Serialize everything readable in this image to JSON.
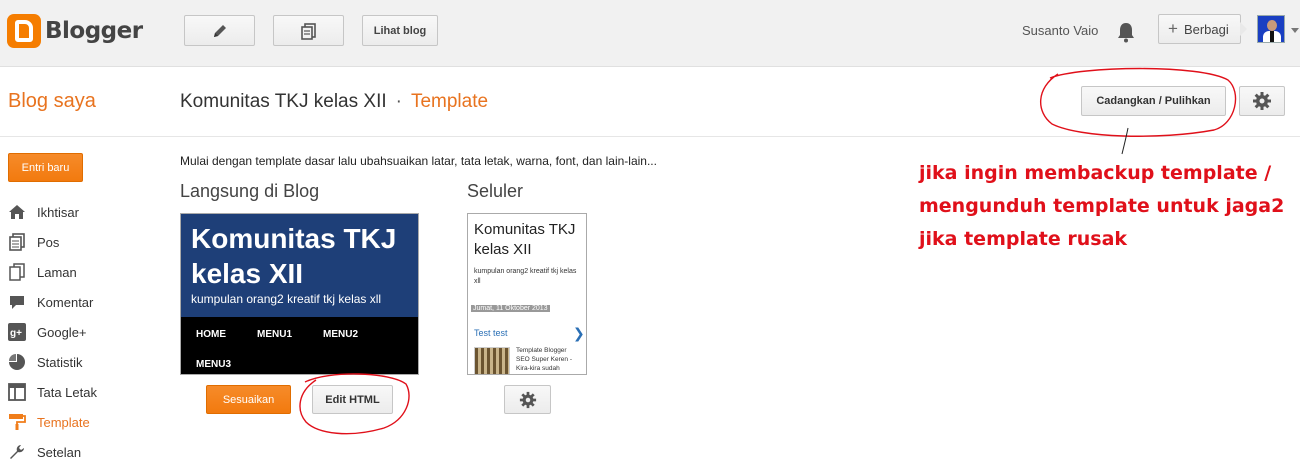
{
  "app": {
    "name": "Blogger",
    "brand_color": "#f57d00"
  },
  "toolbar": {
    "new_post_icon": "pencil-icon",
    "posts_icon": "posts-list-icon",
    "view_blog_label": "Lihat blog"
  },
  "user": {
    "name": "Susanto Vaio",
    "share_label": "Berbagi"
  },
  "titlebar": {
    "my_blogs": "Blog saya",
    "blog_name": "Komunitas TKJ kelas XII",
    "separator": "·",
    "current_page": "Template",
    "backup_label": "Cadangkan / Pulihkan"
  },
  "sidebar": {
    "new_post_label": "Entri baru",
    "items": [
      {
        "label": "Ikhtisar",
        "icon": "home-icon",
        "active": false
      },
      {
        "label": "Pos",
        "icon": "posts-icon",
        "active": false
      },
      {
        "label": "Laman",
        "icon": "pages-icon",
        "active": false
      },
      {
        "label": "Komentar",
        "icon": "comment-icon",
        "active": false
      },
      {
        "label": "Google+",
        "icon": "google-plus-icon",
        "active": false
      },
      {
        "label": "Statistik",
        "icon": "pie-chart-icon",
        "active": false
      },
      {
        "label": "Tata Letak",
        "icon": "layout-icon",
        "active": false
      },
      {
        "label": "Template",
        "icon": "paint-roller-icon",
        "active": true
      },
      {
        "label": "Setelan",
        "icon": "wrench-icon",
        "active": false
      }
    ]
  },
  "main": {
    "intro": "Mulai dengan template dasar lalu ubahsuaikan latar, tata letak, warna, font, dan lain-lain...",
    "live_section_title": "Langsung di Blog",
    "mobile_section_title": "Seluler",
    "blog_preview": {
      "title": "Komunitas TKJ kelas XII",
      "subtitle": "kumpulan orang2 kreatif tkj kelas xll",
      "menu": [
        "HOME",
        "MENU1",
        "MENU2",
        "MENU3"
      ]
    },
    "mobile_preview": {
      "title": "Komunitas TKJ kelas XII",
      "subtitle": "kumpulan orang2 kreatif tkj kelas xll",
      "date": "Jumat, 11 Oktober 2013",
      "post_link": "Test test",
      "item_text": "Template Blogger SEO Super Keren - Kira-kira sudah"
    },
    "customize_label": "Sesuaikan",
    "edit_html_label": "Edit HTML"
  },
  "annotation": {
    "lines": [
      "jika ingin membackup template /",
      "mengunduh template untuk jaga2",
      "jika template rusak"
    ],
    "color": "#e0101a"
  }
}
